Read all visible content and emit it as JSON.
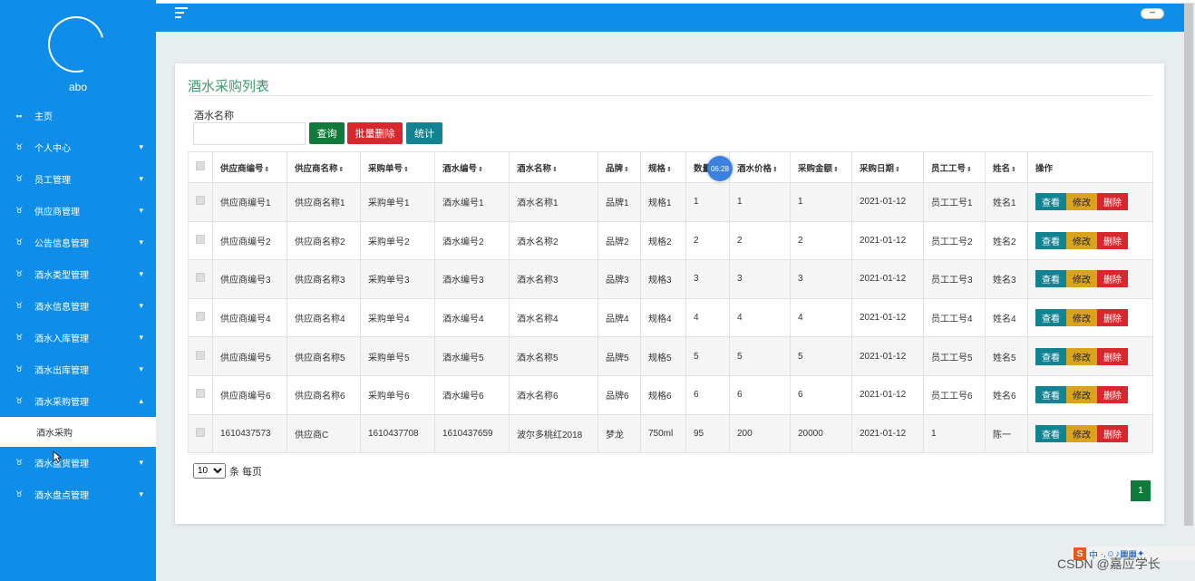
{
  "sidebar": {
    "username": "abo",
    "items": [
      {
        "label": "主页",
        "icon": "dashboard-icon",
        "has_chevron": false
      },
      {
        "label": "个人中心",
        "icon": "module-icon",
        "has_chevron": true,
        "chev": "⌄"
      },
      {
        "label": "员工管理",
        "icon": "module-icon",
        "has_chevron": true,
        "chev": "⌄"
      },
      {
        "label": "供应商管理",
        "icon": "module-icon",
        "has_chevron": true,
        "chev": "⌄"
      },
      {
        "label": "公告信息管理",
        "icon": "module-icon",
        "has_chevron": true,
        "chev": "⌄"
      },
      {
        "label": "酒水类型管理",
        "icon": "module-icon",
        "has_chevron": true,
        "chev": "⌄"
      },
      {
        "label": "酒水信息管理",
        "icon": "module-icon",
        "has_chevron": true,
        "chev": "⌄"
      },
      {
        "label": "酒水入库管理",
        "icon": "module-icon",
        "has_chevron": true,
        "chev": "⌄"
      },
      {
        "label": "酒水出库管理",
        "icon": "module-icon",
        "has_chevron": true,
        "chev": "⌄"
      },
      {
        "label": "酒水采购管理",
        "icon": "module-icon",
        "has_chevron": true,
        "chev": "⌃"
      }
    ],
    "submenu": {
      "label": "酒水采购"
    },
    "items_after": [
      {
        "label": "酒水盘货管理",
        "icon": "module-icon",
        "chev": "⌄"
      },
      {
        "label": "酒水盘点管理",
        "icon": "module-icon",
        "chev": "⌄"
      }
    ]
  },
  "page": {
    "title": "酒水采购列表",
    "search_label": "酒水名称",
    "search_value": "",
    "btn_query": "查询",
    "btn_batch_delete": "批量删除",
    "btn_stat": "统计"
  },
  "table": {
    "headers": [
      "供应商编号",
      "供应商名称",
      "采购单号",
      "酒水编号",
      "酒水名称",
      "品牌",
      "规格",
      "数量",
      "酒水价格",
      "采购金额",
      "采购日期",
      "员工工号",
      "姓名",
      "操作"
    ],
    "sortable": [
      true,
      true,
      true,
      true,
      true,
      true,
      true,
      false,
      true,
      true,
      true,
      true,
      true,
      false
    ],
    "rows": [
      [
        "供应商编号1",
        "供应商名称1",
        "采购单号1",
        "酒水编号1",
        "酒水名称1",
        "品牌1",
        "规格1",
        "1",
        "1",
        "1",
        "2021-01-12",
        "员工工号1",
        "姓名1"
      ],
      [
        "供应商编号2",
        "供应商名称2",
        "采购单号2",
        "酒水编号2",
        "酒水名称2",
        "品牌2",
        "规格2",
        "2",
        "2",
        "2",
        "2021-01-12",
        "员工工号2",
        "姓名2"
      ],
      [
        "供应商编号3",
        "供应商名称3",
        "采购单号3",
        "酒水编号3",
        "酒水名称3",
        "品牌3",
        "规格3",
        "3",
        "3",
        "3",
        "2021-01-12",
        "员工工号3",
        "姓名3"
      ],
      [
        "供应商编号4",
        "供应商名称4",
        "采购单号4",
        "酒水编号4",
        "酒水名称4",
        "品牌4",
        "规格4",
        "4",
        "4",
        "4",
        "2021-01-12",
        "员工工号4",
        "姓名4"
      ],
      [
        "供应商编号5",
        "供应商名称5",
        "采购单号5",
        "酒水编号5",
        "酒水名称5",
        "品牌5",
        "规格5",
        "5",
        "5",
        "5",
        "2021-01-12",
        "员工工号5",
        "姓名5"
      ],
      [
        "供应商编号6",
        "供应商名称6",
        "采购单号6",
        "酒水编号6",
        "酒水名称6",
        "品牌6",
        "规格6",
        "6",
        "6",
        "6",
        "2021-01-12",
        "员工工号6",
        "姓名6"
      ],
      [
        "1610437573",
        "供应商C",
        "1610437708",
        "1610437659",
        "波尔多桃红2018",
        "梦龙",
        "750ml",
        "95",
        "200",
        "20000",
        "2021-01-12",
        "1",
        "陈一"
      ]
    ],
    "actions": {
      "view": "查看",
      "edit": "修改",
      "delete": "删除"
    }
  },
  "pagination": {
    "page_size": "10",
    "page_size_suffix": "条 每页",
    "current_page": "1"
  },
  "overlay": {
    "timer": "06:28",
    "watermark": "CSDN @嘉应学长",
    "ime_label": "中"
  },
  "colors": {
    "sidebar": "#0f8ee9",
    "title": "#3c9a6d",
    "query": "#0f7a3a",
    "delete": "#d9272e",
    "view": "#128390",
    "edit": "#d9a31b"
  }
}
